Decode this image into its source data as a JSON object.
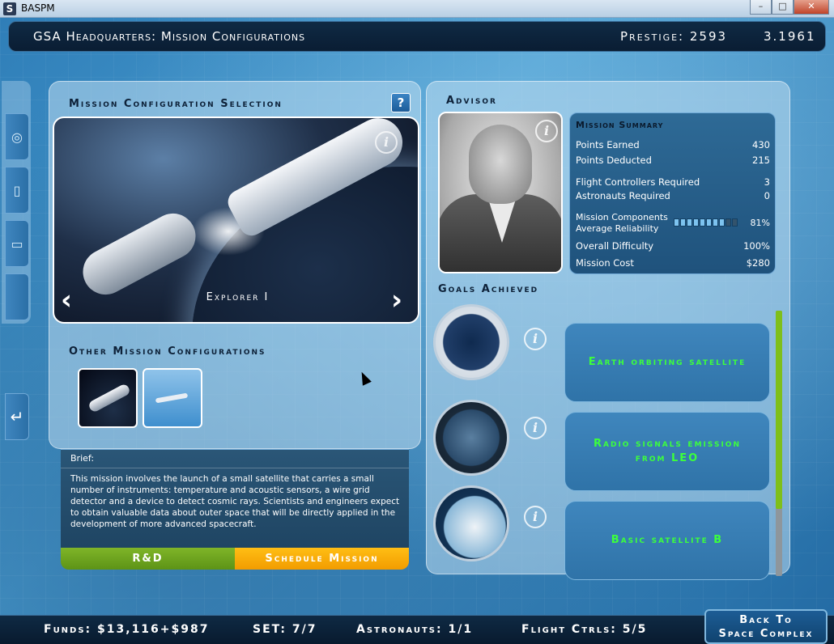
{
  "window": {
    "app_icon": "S",
    "title": "BASPM",
    "minimize_icon": "–",
    "maximize_icon": "□",
    "close_icon": "✕"
  },
  "header": {
    "location": "GSA Headquarters: Mission Configurations",
    "prestige": "Prestige: 2593",
    "version": "3.1961"
  },
  "leftnav": {
    "icons": [
      "target-icon",
      "document-icon",
      "folder-icon",
      "blank-icon"
    ],
    "return_icon": "↵"
  },
  "configuration": {
    "section_title": "Mission Configuration Selection",
    "help_label": "?",
    "current_name": "Explorer I",
    "prev_arrow": "‹",
    "next_arrow": "›",
    "info_label": "i",
    "other_title": "Other Mission Configurations"
  },
  "brief": {
    "label": "Brief:",
    "text": "This mission involves the launch of a small satellite that carries a small number of instruments: temperature and acoustic sensors, a wire grid detector and a device to detect cosmic rays. Scientists and engineers expect to obtain valuable data about outer space that will be directly applied in the development of more advanced spacecraft."
  },
  "actions": {
    "rd_label": "R&D",
    "schedule_label": "Schedule Mission"
  },
  "advisor": {
    "title": "Advisor",
    "info_label": "i"
  },
  "summary": {
    "title": "Mission Summary",
    "points_earned_label": "Points Earned",
    "points_earned": "430",
    "points_deducted_label": "Points Deducted",
    "points_deducted": "215",
    "flight_controllers_label": "Flight Controllers Required",
    "flight_controllers": "3",
    "astronauts_label": "Astronauts Required",
    "astronauts": "0",
    "reliability_label_1": "Mission Components",
    "reliability_label_2": "Average Reliability",
    "reliability": "81%",
    "reliability_fraction": 0.81,
    "difficulty_label": "Overall Difficulty",
    "difficulty": "100%",
    "cost_label": "Mission Cost",
    "cost": "$280"
  },
  "goals": {
    "title": "Goals Achieved",
    "info_label": "i",
    "items": [
      {
        "label": "Earth orbiting satellite"
      },
      {
        "label": "Radio signals emission from LEO"
      },
      {
        "label": "Basic satellite B"
      }
    ]
  },
  "footer": {
    "funds": "Funds: $13,116+$987",
    "set": "SET: 7/7",
    "astronauts": "Astronauts: 1/1",
    "flight_ctrls": "Flight Ctrls: 5/5",
    "back_line1": "Back To",
    "back_line2": "Space Complex"
  }
}
